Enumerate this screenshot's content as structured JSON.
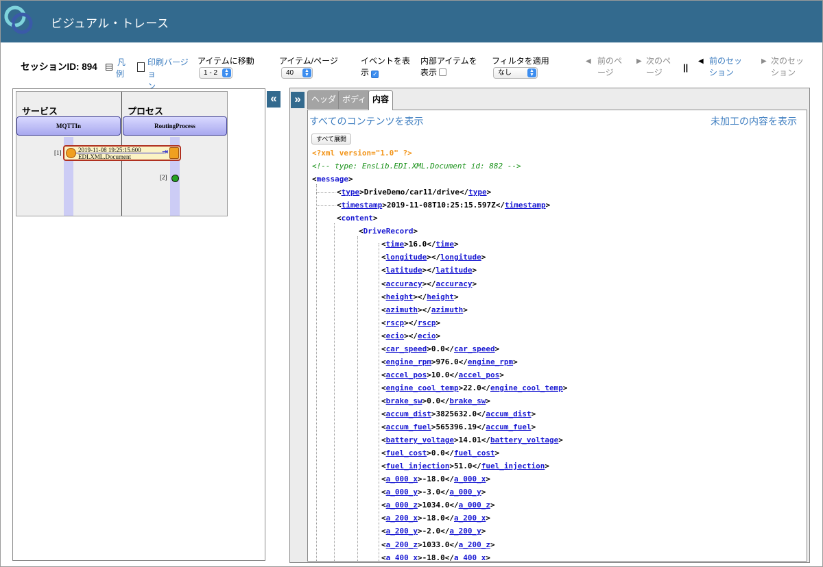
{
  "header": {
    "title": "ビジュアル・トレース"
  },
  "toolbar": {
    "session_id": "セッションID: 894",
    "legend": [
      "凡",
      "例"
    ],
    "print": [
      "印刷バージ",
      "ョン"
    ],
    "goto_label": "アイテムに移動",
    "goto_value": "1 - 2",
    "per_page_label": "アイテム/ページ",
    "per_page_value": "40",
    "show_events": [
      "イベントを表",
      "示"
    ],
    "show_events_checked": true,
    "internal_items": [
      "内部アイテムを",
      "表示"
    ],
    "internal_items_checked": false,
    "filter_label": "フィルタを適用",
    "filter_value": "なし",
    "prev_page": [
      "前のペ",
      "ージ"
    ],
    "next_page": [
      "次のペ",
      "ージ"
    ],
    "separator": "||",
    "prev_session": [
      "前のセッ",
      "ション"
    ],
    "next_session": [
      "次のセッ",
      "ション"
    ],
    "colors": {
      "link": "#3a7bbf",
      "disabled": "#8c8c8c",
      "header": "#336a8e"
    }
  },
  "diagram": {
    "columns": [
      {
        "label": "サービス",
        "component": "MQTTIn"
      },
      {
        "label": "プロセス",
        "component": "RoutingProcess"
      }
    ],
    "messages": [
      {
        "num": "[1]",
        "timestamp": "2019-11-08 19:25:15.600",
        "type": "EDI.XML.Document"
      },
      {
        "num": "[2]"
      }
    ]
  },
  "panels": {
    "collapse_left": "«",
    "collapse_right": "»"
  },
  "tabs": [
    "ヘッダ",
    "ボディ",
    "内容"
  ],
  "active_tab": "内容",
  "content": {
    "show_all": "すべてのコンテンツを表示",
    "show_raw": "未加工の内容を表示",
    "expand_all": "すべて展開",
    "pi": "<?xml version=\"1.0\" ?>",
    "comment": "<!-- type: EnsLib.EDI.XML.Document  id: 882 -->",
    "root": "message",
    "type": {
      "tag": "type",
      "value": "DriveDemo/car11/drive"
    },
    "timestamp": {
      "tag": "timestamp",
      "value": "2019-11-08T10:25:15.597Z"
    },
    "content_tag": "content",
    "record_tag": "DriveRecord",
    "fields": [
      {
        "tag": "time",
        "value": "16.0"
      },
      {
        "tag": "longitude",
        "value": ""
      },
      {
        "tag": "latitude",
        "value": ""
      },
      {
        "tag": "accuracy",
        "value": ""
      },
      {
        "tag": "height",
        "value": ""
      },
      {
        "tag": "azimuth",
        "value": ""
      },
      {
        "tag": "rscp",
        "value": ""
      },
      {
        "tag": "ecio",
        "value": ""
      },
      {
        "tag": "car_speed",
        "value": "0.0"
      },
      {
        "tag": "engine_rpm",
        "value": "976.0"
      },
      {
        "tag": "accel_pos",
        "value": "10.0"
      },
      {
        "tag": "engine_cool_temp",
        "value": "22.0"
      },
      {
        "tag": "brake_sw",
        "value": "0.0"
      },
      {
        "tag": "accum_dist",
        "value": "3825632.0"
      },
      {
        "tag": "accum_fuel",
        "value": "565396.19"
      },
      {
        "tag": "battery_voltage",
        "value": "14.01"
      },
      {
        "tag": "fuel_cost",
        "value": "0.0"
      },
      {
        "tag": "fuel_injection",
        "value": "51.0"
      },
      {
        "tag": "a_000_x",
        "value": "-18.0"
      },
      {
        "tag": "a_000_y",
        "value": "-3.0"
      },
      {
        "tag": "a_000_z",
        "value": "1034.0"
      },
      {
        "tag": "a_200_x",
        "value": "-18.0"
      },
      {
        "tag": "a_200_y",
        "value": "-2.0"
      },
      {
        "tag": "a_200_z",
        "value": "1033.0"
      },
      {
        "tag": "a_400_x",
        "value": "-18.0"
      }
    ]
  }
}
